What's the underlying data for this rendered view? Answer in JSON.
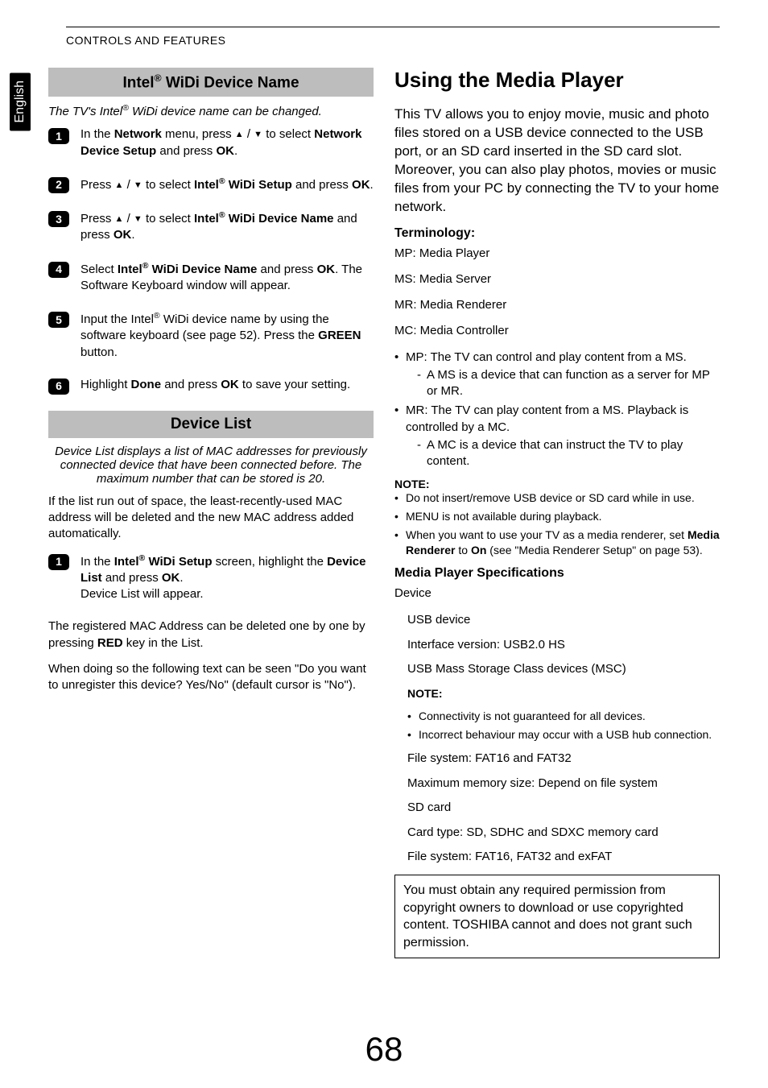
{
  "sideTab": "English",
  "headerLabel": "CONTROLS AND FEATURES",
  "pageNumber": "68",
  "left": {
    "sec1": {
      "title_pre": "Intel",
      "title_sup": "®",
      "title_post": " WiDi Device Name",
      "caption_pre": "The TV's Intel",
      "caption_sup": "®",
      "caption_post": " WiDi device name can be changed.",
      "steps": {
        "s1_a": "In the ",
        "s1_b": "Network",
        "s1_c": " menu, press ",
        "s1_d": " / ",
        "s1_e": " to select ",
        "s1_f": "Network Device Setup",
        "s1_g": " and press ",
        "s1_h": "OK",
        "s1_i": ".",
        "s2_a": "Press ",
        "s2_b": " / ",
        "s2_c": " to select ",
        "s2_d_pre": "Intel",
        "s2_d_sup": "®",
        "s2_d_post": " WiDi Setup",
        "s2_e": " and press ",
        "s2_f": "OK",
        "s2_g": ".",
        "s3_a": "Press ",
        "s3_b": " / ",
        "s3_c": " to select ",
        "s3_d_pre": "Intel",
        "s3_d_sup": "®",
        "s3_d_post": " WiDi Device Name",
        "s3_e": " and press ",
        "s3_f": "OK",
        "s3_g": ".",
        "s4_a": "Select ",
        "s4_b_pre": "Intel",
        "s4_b_sup": "®",
        "s4_b_post": " WiDi Device Name",
        "s4_c": " and press ",
        "s4_d": "OK",
        "s4_e": ". The Software Keyboard window will appear.",
        "s5_a": "Input the Intel",
        "s5_sup": "®",
        "s5_b": " WiDi device name by using the software keyboard (see page 52). Press the ",
        "s5_c": "GREEN",
        "s5_d": " button.",
        "s6_a": "Highlight ",
        "s6_b": "Done",
        "s6_c": " and press ",
        "s6_d": "OK",
        "s6_e": " to save your setting."
      }
    },
    "sec2": {
      "title": "Device List",
      "caption": "Device List displays a list of MAC addresses for previously connected device that have been connected before. The maximum number that can be stored is 20.",
      "para1": "If the list run out of space, the least-recently-used MAC address will be deleted and the new MAC address added automatically.",
      "step1_a": "In the ",
      "step1_b_pre": "Intel",
      "step1_b_sup": "®",
      "step1_b_post": " WiDi Setup",
      "step1_c": " screen, highlight the ",
      "step1_d": "Device List",
      "step1_e": " and press ",
      "step1_f": "OK",
      "step1_g": ".",
      "step1_line2": "Device List will appear.",
      "para2_a": "The registered MAC Address can be deleted one by one by pressing ",
      "para2_b": "RED",
      "para2_c": " key in the List.",
      "para3": "When doing so the following text can be seen \"Do you want to unregister this device? Yes/No\" (default cursor is \"No\")."
    }
  },
  "right": {
    "h1": "Using the Media Player",
    "intro": "This TV allows you to enjoy movie, music and photo files stored on a USB device connected to the USB port, or an SD card inserted in the SD card slot.\nMoreover, you can also play photos, movies or music files from your PC by connecting the TV to your home network.",
    "termLabel": "Terminology:",
    "terms": {
      "mp": "MP: Media Player",
      "ms": "MS: Media Server",
      "mr": "MR: Media Renderer",
      "mc": "MC: Media Controller"
    },
    "roles": {
      "b1": "MP: The TV can control and play content from a MS.",
      "b1s": "A MS is a device that can function as a server for MP or MR.",
      "b2": "MR: The TV can play content from a MS. Playback is controlled by a MC.",
      "b2s": "A MC is a device that can instruct the TV to play content."
    },
    "note1": {
      "label": "NOTE:",
      "n1": "Do not insert/remove USB device or SD card while in use.",
      "n2": "MENU is not available during playback.",
      "n3_a": "When you want to use your TV as a media renderer, set ",
      "n3_b": "Media Renderer",
      "n3_c": " to ",
      "n3_d": "On",
      "n3_e": " (see \"Media Renderer Setup\" on page 53)."
    },
    "specHead": "Media Player Specifications",
    "deviceLabel": "Device",
    "specs": {
      "usbDevice": "USB device",
      "iface": "Interface version: USB2.0 HS",
      "msc": "USB Mass Storage Class devices (MSC)",
      "noteLabel": "NOTE:",
      "noteA": "Connectivity is not guaranteed for all devices.",
      "noteB": "Incorrect behaviour may occur with a USB hub connection.",
      "fs1": "File system: FAT16 and FAT32",
      "mem": "Maximum memory size: Depend on file system",
      "sd": "SD card",
      "card": "Card type: SD, SDHC and SDXC memory card",
      "fs2": "File system: FAT16, FAT32 and exFAT"
    },
    "boxed": "You must obtain any required permission from copyright owners to download or use copyrighted content. TOSHIBA cannot and does not grant such permission."
  }
}
